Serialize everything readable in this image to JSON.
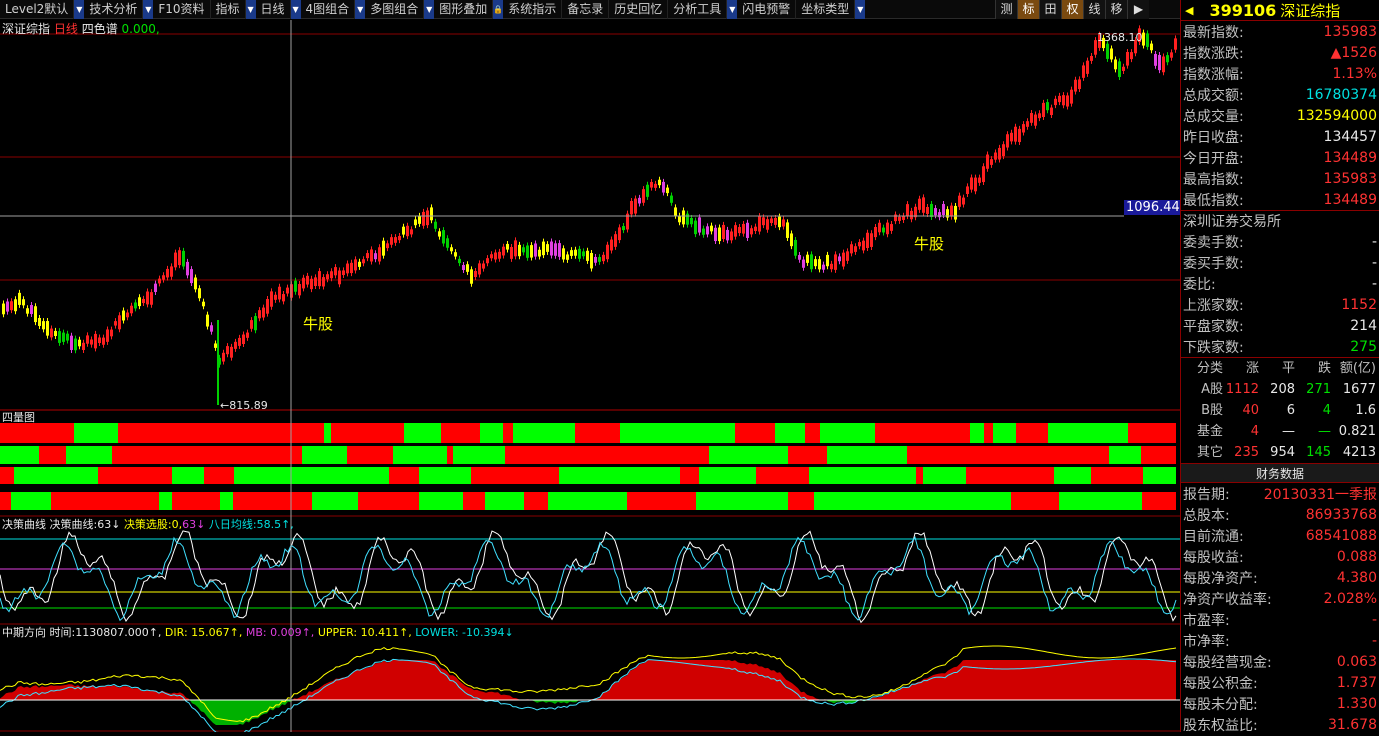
{
  "toolbar": {
    "items": [
      "Level2默认",
      "技术分析",
      "F10资料",
      "指标",
      "日线",
      "4图组合",
      "多图组合",
      "图形叠加",
      "系统指示",
      "备忘录",
      "历史回忆",
      "分析工具",
      "闪电预警",
      "坐标类型"
    ],
    "right_tools": [
      "测",
      "标",
      "田",
      "权",
      "线",
      "移",
      "▶"
    ]
  },
  "chart": {
    "title": "深证综指",
    "period": "日线",
    "style": "四色谱",
    "value": "0.000,",
    "high_label": "1368.10",
    "low_label": "815.89",
    "crosshair_price": "1096.44",
    "signal_labels": [
      "牛股",
      "牛股"
    ]
  },
  "panel2": {
    "title": "四量图"
  },
  "panel3": {
    "title": "决策曲线",
    "name": "决策曲线:",
    "v1": "63↓",
    "v2_name": "决策选股:",
    "v2": "0,",
    "v3": "63↓",
    "v4_name": "八日均线:",
    "v4": "58.5↑,"
  },
  "panel4": {
    "title": "中期方向",
    "time_label": "时间:",
    "time": "1130807.000↑,",
    "dir": "DIR: 15.067↑,",
    "mb": "MB: 0.009↑,",
    "upper": "UPPER: 10.411↑,",
    "lower": "LOWER: -10.394↓"
  },
  "side": {
    "code": "399106",
    "name": "深证综指",
    "quotes": [
      {
        "k": "最新指数:",
        "v": "135983",
        "c": "red"
      },
      {
        "k": "指数涨跌:",
        "v": "▲1526",
        "c": "red"
      },
      {
        "k": "指数涨幅:",
        "v": "1.13%",
        "c": "red"
      },
      {
        "k": "总成交额:",
        "v": "16780374",
        "c": "cyn"
      },
      {
        "k": "总成交量:",
        "v": "132594000",
        "c": "yel"
      },
      {
        "k": "昨日收盘:",
        "v": "134457",
        "c": "wht"
      },
      {
        "k": "今日开盘:",
        "v": "134489",
        "c": "red"
      },
      {
        "k": "最高指数:",
        "v": "135983",
        "c": "red"
      },
      {
        "k": "最低指数:",
        "v": "134489",
        "c": "red"
      }
    ],
    "exchange": "深圳证券交易所",
    "orders": [
      {
        "k": "委卖手数:",
        "v": "-",
        "c": "wht"
      },
      {
        "k": "委买手数:",
        "v": "-",
        "c": "wht"
      },
      {
        "k": "委比:",
        "v": "-",
        "c": "wht"
      },
      {
        "k": "上涨家数:",
        "v": "1152",
        "c": "red"
      },
      {
        "k": "平盘家数:",
        "v": "214",
        "c": "wht"
      },
      {
        "k": "下跌家数:",
        "v": "275",
        "c": "grn"
      }
    ],
    "market_header": [
      "分类",
      "涨",
      "平",
      "跌",
      "额(亿)"
    ],
    "market_rows": [
      [
        "A股",
        "1112",
        "208",
        "271",
        "1677"
      ],
      [
        "B股",
        "40",
        "6",
        "4",
        "1.6"
      ],
      [
        "基金",
        "4",
        "—",
        "—",
        "0.821"
      ],
      [
        "其它",
        "235",
        "954",
        "145",
        "4213"
      ]
    ],
    "fin_title": "财务数据",
    "finance": [
      {
        "k": "报告期:",
        "v": "20130331一季报",
        "c": "red"
      },
      {
        "k": "总股本:",
        "v": "86933768",
        "c": "red"
      },
      {
        "k": "目前流通:",
        "v": "68541088",
        "c": "red"
      },
      {
        "k": "每股收益:",
        "v": "0.088",
        "c": "red"
      },
      {
        "k": "每股净资产:",
        "v": "4.380",
        "c": "red"
      },
      {
        "k": "净资产收益率:",
        "v": "2.028%",
        "c": "red"
      },
      {
        "k": "市盈率:",
        "v": "-",
        "c": "red"
      },
      {
        "k": "市净率:",
        "v": "-",
        "c": "red"
      },
      {
        "k": "每股经营现金:",
        "v": "0.063",
        "c": "red"
      },
      {
        "k": "每股公积金:",
        "v": "1.737",
        "c": "red"
      },
      {
        "k": "每股未分配:",
        "v": "1.330",
        "c": "red"
      },
      {
        "k": "股东权益比:",
        "v": "31.678",
        "c": "red"
      }
    ]
  },
  "colors": {
    "up": "#ff2020",
    "down": "#00d000",
    "yellow": "#ffff00",
    "magenta": "#e040e0",
    "cyan": "#40e0ff"
  }
}
